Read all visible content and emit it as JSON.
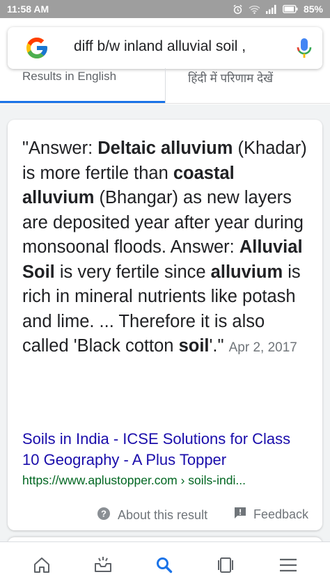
{
  "status_bar": {
    "time": "11:58 AM",
    "battery": "85%",
    "icons": [
      "alarm-icon",
      "wifi-icon",
      "signal-icon",
      "battery-icon"
    ]
  },
  "search": {
    "query": "diff b/w inland alluvial soil ,",
    "logo": "google-logo",
    "voice_icon": "mic-icon"
  },
  "tabs": [
    {
      "label": "Results in English",
      "active": true
    },
    {
      "label": "हिंदी में परिणाम देखें",
      "active": false
    }
  ],
  "snippet": {
    "segments": [
      {
        "text": "\"Answer: ",
        "bold": false
      },
      {
        "text": "Deltaic alluvium",
        "bold": true
      },
      {
        "text": " (Khadar) is more fertile than ",
        "bold": false
      },
      {
        "text": "coastal alluvium",
        "bold": true
      },
      {
        "text": " (Bhangar) as new layers are deposited year after year during monsoonal floods. Answer: ",
        "bold": false
      },
      {
        "text": "Alluvial Soil",
        "bold": true
      },
      {
        "text": " is very fertile since ",
        "bold": false
      },
      {
        "text": "alluvium",
        "bold": true
      },
      {
        "text": " is rich in mineral nutrients like potash and lime. ... Therefore it is also called 'Black cotton ",
        "bold": false
      },
      {
        "text": "soil",
        "bold": true
      },
      {
        "text": "'.\"",
        "bold": false
      }
    ],
    "date": "Apr 2, 2017",
    "source_title": "Soils in India - ICSE Solutions for Class 10 Geography - A Plus Topper",
    "source_url": "https://www.aplustopper.com › soils-indi..."
  },
  "card_footer": {
    "about_label": "About this result",
    "feedback_label": "Feedback"
  },
  "bottom_nav": [
    "home-icon",
    "updates-icon",
    "search-icon",
    "tabs-icon",
    "menu-icon"
  ],
  "colors": {
    "status_bar": "#9e9e9e",
    "link": "#1a0dab",
    "url": "#006621",
    "accent": "#1a73e8",
    "muted": "#70757a"
  }
}
